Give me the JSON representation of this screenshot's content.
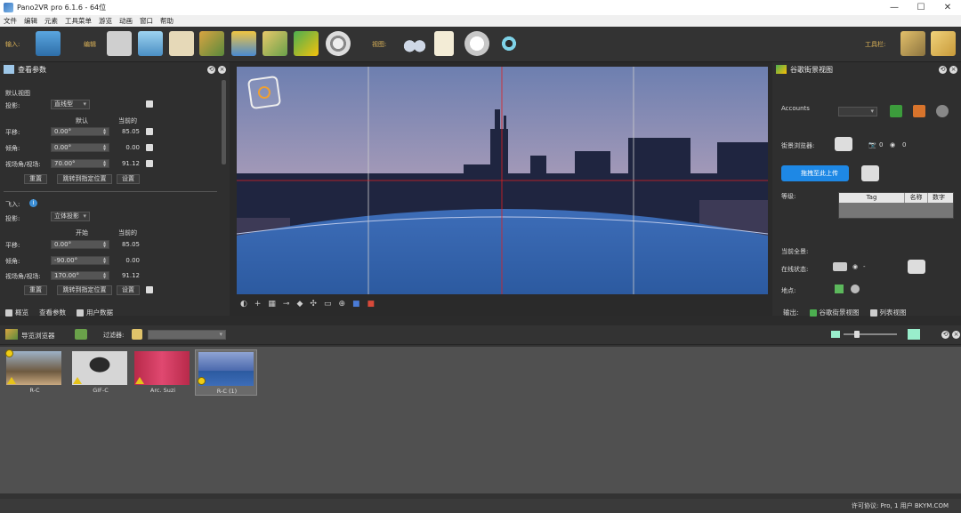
{
  "window": {
    "title": "Pano2VR pro 6.1.6 - 64位",
    "controls": [
      "—",
      "☐",
      "✕"
    ]
  },
  "menu": [
    "文件",
    "编辑",
    "元素",
    "工具菜单",
    "游览",
    "动画",
    "窗口",
    "帮助"
  ],
  "toolbar": {
    "input_label": "输入:",
    "edit_label": "编辑",
    "view_label": "视图:",
    "toolbar_label": "工具栏:"
  },
  "view_params": {
    "title": "查看参数",
    "section": "默认视图",
    "projection_label": "投影:",
    "projection_value": "直线型",
    "col_default": "默认",
    "col_current": "当前的",
    "rows": [
      {
        "label": "平移:",
        "default": "0.00°",
        "current": "85.05"
      },
      {
        "label": "倾角:",
        "default": "0.00°",
        "current": "0.00"
      },
      {
        "label": "视场角/视场:",
        "default": "70.00°",
        "current": "91.12"
      }
    ],
    "btn_reset": "重置",
    "btn_jump": "跳转到指定位置",
    "btn_set": "设置",
    "flyin_label": "飞入:",
    "flyin_projection_label": "投影:",
    "flyin_projection_value": "立体投影",
    "col_start": "开始",
    "col_current2": "当前的",
    "flyin_rows": [
      {
        "label": "平移:",
        "default": "0.00°",
        "current": "85.05"
      },
      {
        "label": "倾角:",
        "default": "-90.00°",
        "current": "0.00"
      },
      {
        "label": "视场角/视场:",
        "default": "170.00°",
        "current": "91.12"
      }
    ],
    "btn_reset2": "重置",
    "btn_jump2": "跳转到指定位置",
    "btn_set2": "设置"
  },
  "left_tabs": [
    "概览",
    "查看参数",
    "用户数据"
  ],
  "google": {
    "title": "谷歌街景视图",
    "accounts_label": "Accounts",
    "browser_label": "街景浏览器:",
    "photo_count": "0",
    "view_count": "0",
    "upload_btn": "拖拽至此上传",
    "level_label": "等级:",
    "table_headers": [
      "Tag",
      "名称",
      "数字"
    ],
    "current_scene_label": "当前全景:",
    "online_status_label": "在线状态:",
    "online_status_value": "-",
    "place_label": "地点:"
  },
  "right_tabs": [
    "输出:",
    "谷歌街景视图",
    "列表视图"
  ],
  "tour": {
    "title": "导览浏览器",
    "filter_label": "过滤器:",
    "items": [
      {
        "caption": "R-C",
        "color": "#7a6a55"
      },
      {
        "caption": "GIF-C",
        "color": "#cfcfcf"
      },
      {
        "caption": "Arc. Suzi",
        "color": "#c0304d"
      },
      {
        "caption": "R-C (1)",
        "color": "#3a62a8"
      }
    ]
  },
  "status": {
    "license": "许可协议: Pro, 1 用户 BKYM.COM"
  },
  "colors": {
    "accent": "#ddb458",
    "upload_btn": "#1e88e5"
  }
}
